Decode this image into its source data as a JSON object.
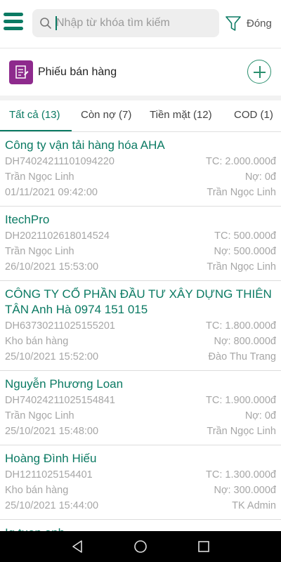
{
  "search": {
    "placeholder": "Nhập từ khóa tìm kiếm"
  },
  "topbar": {
    "close_label": "Đóng"
  },
  "section": {
    "title": "Phiếu bán hàng"
  },
  "tabs": [
    {
      "label": "Tất cả (13)",
      "active": true
    },
    {
      "label": "Còn nợ (7)",
      "active": false
    },
    {
      "label": "Tiền mặt (12)",
      "active": false
    },
    {
      "label": "COD (1)",
      "active": false
    }
  ],
  "orders": [
    {
      "customer": "Công ty vận tải hàng hóa AHA",
      "code": "DH74024211101094220",
      "total": "TC: 2.000.000đ",
      "seller": "Trần Ngọc Linh",
      "debt": "Nợ: 0đ",
      "datetime": "01/11/2021 09:42:00",
      "creator": "Trần Ngọc Linh"
    },
    {
      "customer": "ItechPro",
      "code": "DH2021102618014524",
      "total": "TC: 500.000đ",
      "seller": "Trần Ngọc Linh",
      "debt": "Nợ: 500.000đ",
      "datetime": "26/10/2021 15:53:00",
      "creator": "Trần Ngọc Linh"
    },
    {
      "customer": "CÔNG TY CỔ PHẦN ĐẦU TƯ XÂY DỰNG THIÊN TÂN Anh Hà 0974 151 015",
      "code": "DH63730211025155201",
      "total": "TC: 1.800.000đ",
      "seller": "Kho bán hàng",
      "debt": "Nợ: 800.000đ",
      "datetime": "25/10/2021 15:52:00",
      "creator": "Đào Thu Trang"
    },
    {
      "customer": "Nguyễn Phương Loan",
      "code": "DH74024211025154841",
      "total": "TC: 1.900.000đ",
      "seller": "Trần Ngọc Linh",
      "debt": "Nợ: 0đ",
      "datetime": "25/10/2021 15:48:00",
      "creator": "Trần Ngọc Linh"
    },
    {
      "customer": "Hoàng Đình Hiếu",
      "code": "DH1211025154401",
      "total": "TC: 1.300.000đ",
      "seller": "Kho bán hàng",
      "debt": "Nợ: 300.000đ",
      "datetime": "25/10/2021 15:44:00",
      "creator": "TK Admin"
    },
    {
      "customer": "Ig tuan anh"
    }
  ],
  "colors": {
    "accent": "#0b7a63",
    "doc_icon_bg": "#8e2a8d"
  },
  "icons": {
    "menu": "hamburger-icon",
    "search": "search-icon",
    "filter": "filter-icon",
    "add": "plus-circle-icon",
    "doc": "document-icon"
  }
}
